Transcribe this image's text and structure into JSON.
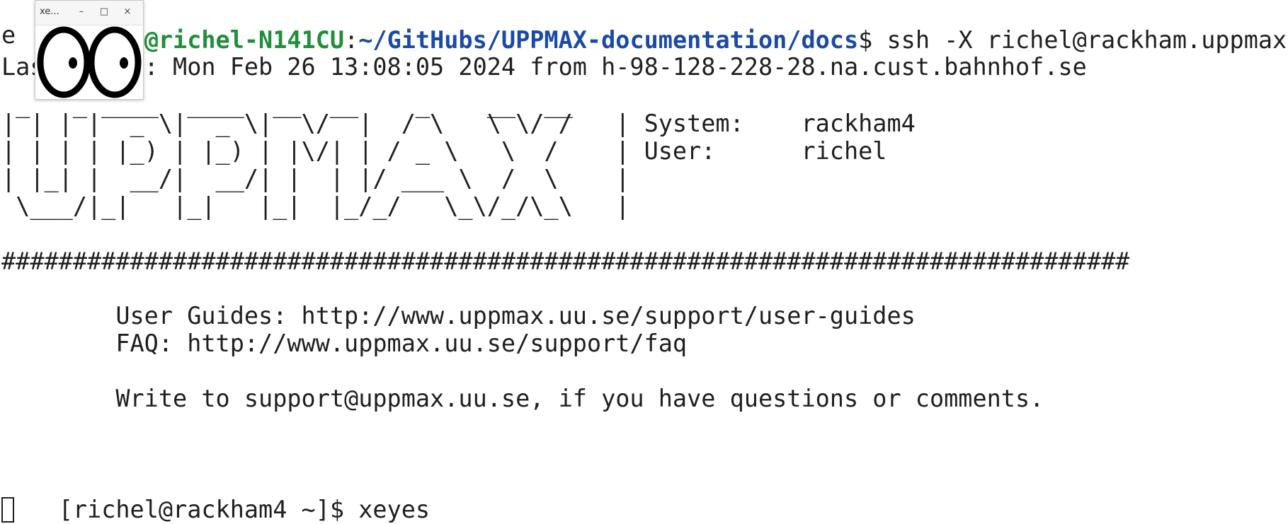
{
  "terminal": {
    "prompt_user_host": "richel@richel-N141CU",
    "prompt_sep": ":",
    "prompt_path": "~/GitHubs/UPPMAX-documentation/docs",
    "prompt_dollar": "$",
    "command": " ssh -X richel@rackham.uppmax.uu.s",
    "command_wrap": "e",
    "last_login": "Last login: Mon Feb 26 13:08:05 2024 from h-98-128-228-28.na.cust.bahnhof.se",
    "banner": [
      " _   _ ____  ____  __  __    _    __  __",
      "| | | |  _ \\|  _ \\|  \\/  |  / \\   \\ \\/ /   | System:    rackham4",
      "| | | | |_) | |_) | |\\/| | / _ \\   \\  /    | User:      richel",
      "| |_| |  __/|  __/| |  | |/ ___ \\  /  \\    |",
      " \\___/|_|   |_|   |_|  |_/_/   \\_\\/_/\\_\\   |"
    ],
    "hash_rule": "###############################################################################",
    "guides": "        User Guides: http://www.uppmax.uu.se/support/user-guides",
    "faq": "        FAQ: http://www.uppmax.uu.se/support/faq",
    "write_to": "        Write to support@uppmax.uu.se, if you have questions or comments.",
    "remote_prompt": "[richel@rackham4 ~]$",
    "remote_command": " xeyes"
  },
  "xeyes_window": {
    "title": "xe...",
    "minimize_icon": "–",
    "maximize_icon": "□",
    "close_icon": "×"
  }
}
